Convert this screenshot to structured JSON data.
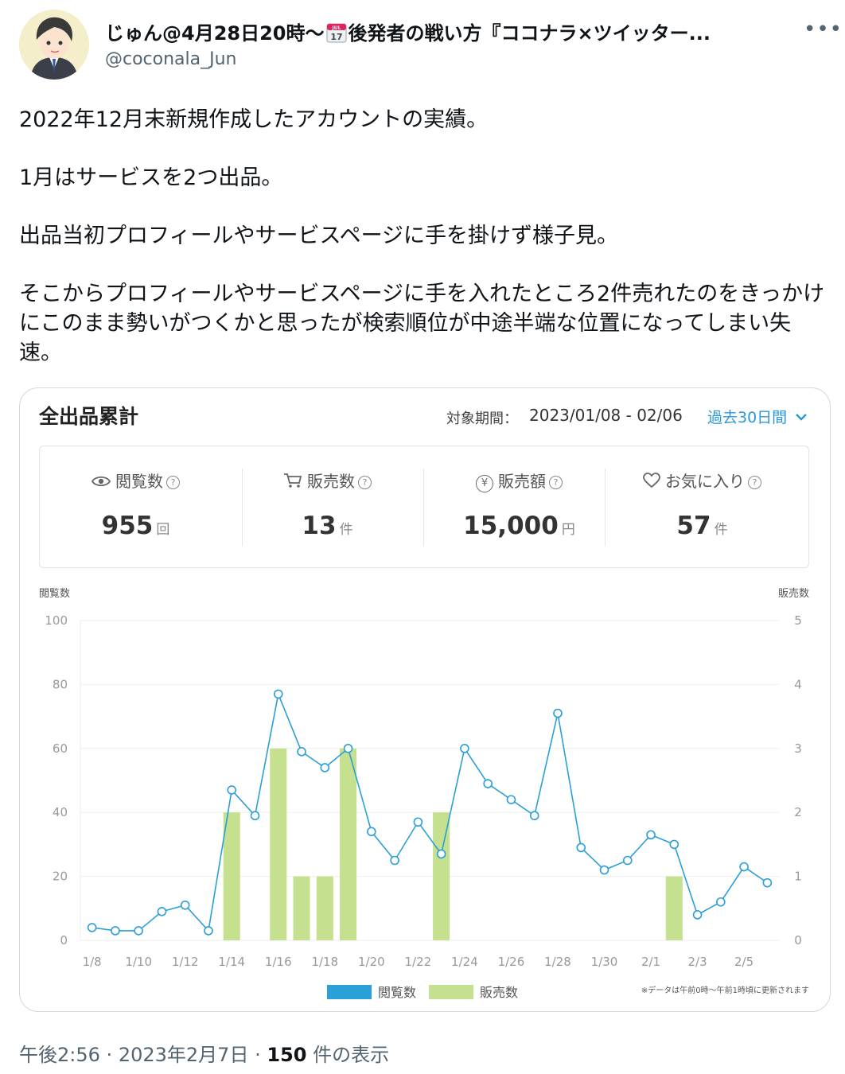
{
  "tweet": {
    "display_name_before": "じゅん@4月28日20時〜",
    "calendar_month": "JUL",
    "calendar_day": "17",
    "display_name_after": "後発者の戦い方『ココナラ×ツイッター...",
    "handle": "@coconala_Jun",
    "more": "•••",
    "paragraphs": [
      "2022年12月末新規作成したアカウントの実績。",
      "1月はサービスを2つ出品。",
      "出品当初プロフィールやサービスページに手を掛けず様子見。",
      "そこからプロフィールやサービスページに手を入れたところ2件売れたのをきっかけにこのまま勢いがつくかと思ったが検索順位が中途半端な位置になってしまい失速。"
    ],
    "time": "午後2:56",
    "date": "2023年2月7日",
    "views_count": "150",
    "views_label": "件の表示",
    "separator": "·"
  },
  "card": {
    "title": "全出品累計",
    "period_label": "対象期間：",
    "period_value": "2023/01/08 - 02/06",
    "period_select": "過去30日間",
    "stats": [
      {
        "label": "閲覧数",
        "value": "955",
        "unit": "回",
        "icon": "eye-icon"
      },
      {
        "label": "販売数",
        "value": "13",
        "unit": "件",
        "icon": "cart-icon"
      },
      {
        "label": "販売額",
        "value": "15,000",
        "unit": "円",
        "icon": "yen-icon"
      },
      {
        "label": "お気に入り",
        "value": "57",
        "unit": "件",
        "icon": "heart-icon"
      }
    ],
    "help_glyph": "?",
    "yen_glyph": "¥"
  },
  "chart_data": {
    "type": "bar",
    "categories": [
      "1/8",
      "1/9",
      "1/10",
      "1/11",
      "1/12",
      "1/13",
      "1/14",
      "1/15",
      "1/16",
      "1/17",
      "1/18",
      "1/19",
      "1/20",
      "1/21",
      "1/22",
      "1/23",
      "1/24",
      "1/25",
      "1/26",
      "1/27",
      "1/28",
      "1/29",
      "1/30",
      "1/31",
      "2/1",
      "2/2",
      "2/3",
      "2/4",
      "2/5",
      "2/6"
    ],
    "xtick_labels": [
      "1/8",
      "1/10",
      "1/12",
      "1/14",
      "1/16",
      "1/18",
      "1/20",
      "1/22",
      "1/24",
      "1/26",
      "1/28",
      "1/30",
      "2/1",
      "2/3",
      "2/5"
    ],
    "series": [
      {
        "name": "閲覧数",
        "type": "line",
        "axis": "left",
        "color": "#2a9fd8",
        "values": [
          4,
          3,
          3,
          9,
          11,
          3,
          47,
          39,
          77,
          59,
          54,
          60,
          34,
          25,
          37,
          27,
          60,
          49,
          44,
          39,
          71,
          29,
          22,
          25,
          33,
          30,
          8,
          12,
          23,
          18
        ]
      },
      {
        "name": "販売数",
        "type": "bar",
        "axis": "right",
        "color": "#c5e08f",
        "values": [
          0,
          0,
          0,
          0,
          0,
          0,
          2,
          0,
          3,
          1,
          1,
          3,
          0,
          0,
          0,
          2,
          0,
          0,
          0,
          0,
          0,
          0,
          0,
          0,
          0,
          1,
          0,
          0,
          0,
          0
        ]
      }
    ],
    "ylabel_left": "閲覧数",
    "ylabel_right": "販売数",
    "ylim_left": [
      0,
      100
    ],
    "ylim_right": [
      0,
      5
    ],
    "yticks_left": [
      0,
      20,
      40,
      60,
      80,
      100
    ],
    "yticks_right": [
      0,
      1,
      2,
      3,
      4,
      5
    ],
    "grid": true,
    "legend_position": "bottom",
    "note": "※データは午前0時〜午前1時頃に更新されます"
  }
}
